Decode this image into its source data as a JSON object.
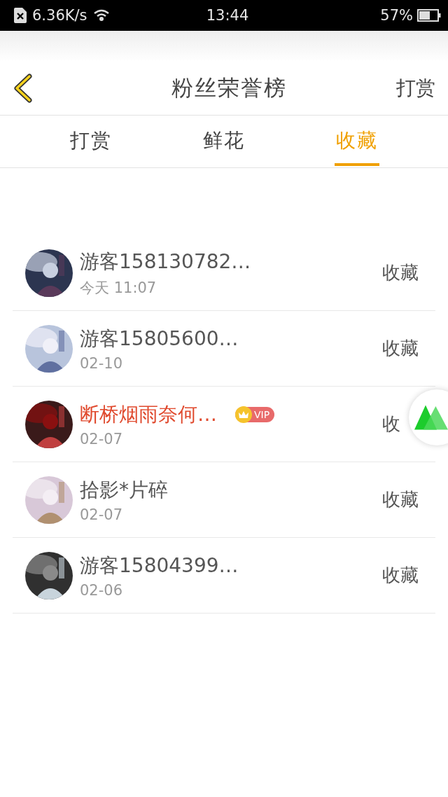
{
  "status_bar": {
    "speed": "6.36K/s",
    "time": "13:44",
    "battery": "57%"
  },
  "header": {
    "title": "粉丝荣誉榜",
    "action": "打赏"
  },
  "tabs": [
    {
      "label": "打赏",
      "selected": false
    },
    {
      "label": "鲜花",
      "selected": false
    },
    {
      "label": "收藏",
      "selected": true
    }
  ],
  "rows": [
    {
      "name": "游客158130782…",
      "time": "今天 11:07",
      "vip": false,
      "action": "收藏"
    },
    {
      "name": "游客15805600…",
      "time": "02-10",
      "vip": false,
      "action": "收藏"
    },
    {
      "name": "断桥烟雨奈何…",
      "time": "02-07",
      "vip": true,
      "badge": "VIP",
      "action": "收"
    },
    {
      "name": "拾影*片碎",
      "time": "02-07",
      "vip": false,
      "action": "收藏"
    },
    {
      "name": "游客15804399…",
      "time": "02-06",
      "vip": false,
      "action": "收藏"
    }
  ]
}
